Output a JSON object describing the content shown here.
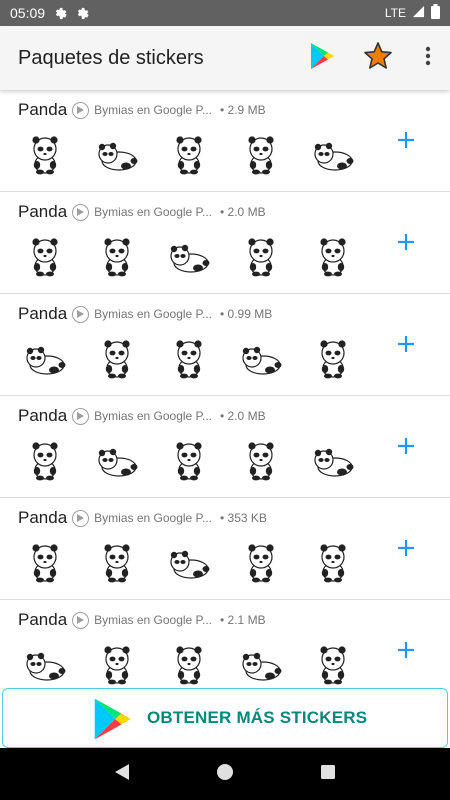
{
  "status_bar": {
    "time": "05:09",
    "network": "LTE"
  },
  "app_bar": {
    "title": "Paquetes de stickers"
  },
  "packs": [
    {
      "name": "Panda",
      "publisher": "Bymias en Google P...",
      "size": "• 2.9 MB"
    },
    {
      "name": "Panda",
      "publisher": "Bymias en Google P...",
      "size": "• 2.0 MB"
    },
    {
      "name": "Panda",
      "publisher": "Bymias en Google P...",
      "size": "• 0.99 MB"
    },
    {
      "name": "Panda",
      "publisher": "Bymias en Google P...",
      "size": "• 2.0 MB"
    },
    {
      "name": "Panda",
      "publisher": "Bymias en Google P...",
      "size": "• 353 KB"
    },
    {
      "name": "Panda",
      "publisher": "Bymias en Google P...",
      "size": "• 2.1 MB"
    }
  ],
  "get_more": {
    "label": "OBTENER MÁS STICKERS"
  },
  "colors": {
    "accent_blue": "#2196f3",
    "teal": "#00897b",
    "status_bar": "#616161"
  },
  "icons": [
    "gear-icon",
    "battery-icon",
    "play-store-icon",
    "star-icon",
    "more-vert-icon",
    "play-icon",
    "add-icon",
    "back-icon",
    "home-icon",
    "recents-icon"
  ]
}
